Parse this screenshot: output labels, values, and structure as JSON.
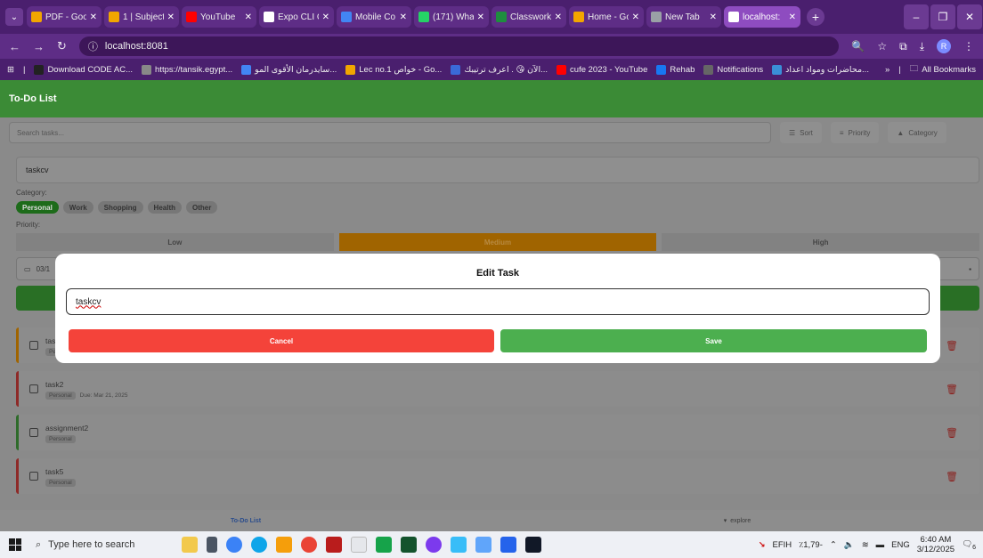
{
  "browser": {
    "tabs": [
      {
        "title": "PDF - Goo",
        "color": "#f2a600"
      },
      {
        "title": "1 | Subject",
        "color": "#f2a600"
      },
      {
        "title": "YouTube",
        "color": "#ff0000"
      },
      {
        "title": "Expo CLI C",
        "color": "#ffffff"
      },
      {
        "title": "Mobile Co",
        "color": "#4285f4"
      },
      {
        "title": "(171) Wha",
        "color": "#25d366"
      },
      {
        "title": "Classwork",
        "color": "#1e8e3e"
      },
      {
        "title": "Home - Go",
        "color": "#f2a600"
      },
      {
        "title": "New Tab",
        "color": "#9aa0a6"
      },
      {
        "title": "localhost:",
        "color": "#ffffff",
        "active": true
      }
    ],
    "url": "localhost:8081",
    "profile_initial": "R",
    "bookmarks": [
      {
        "label": "Download CODE AC...",
        "color": "#222"
      },
      {
        "label": "https://tansik.egypt...",
        "color": "#888"
      },
      {
        "label": "سايدرمان الأقوى المو...",
        "color": "#4285f4"
      },
      {
        "label": "Lec no.1 خواص - Go...",
        "color": "#f2a600"
      },
      {
        "label": "الآن 😘 . اعرف ترتيبك...",
        "color": "#3a6ad8"
      },
      {
        "label": "cufe 2023 - YouTube",
        "color": "#ff0000"
      },
      {
        "label": "Rehab",
        "color": "#1877f2"
      },
      {
        "label": "Notifications",
        "color": "#666"
      },
      {
        "label": "محاضرات ومواد اعداد...",
        "color": "#3a8fd8"
      }
    ],
    "bookmarks_more": "»",
    "all_bookmarks": "All Bookmarks"
  },
  "app": {
    "title": "To-Do List",
    "search_placeholder": "Search tasks...",
    "sort_label": "Sort",
    "priority_label": "Priority",
    "category_label": "Category",
    "task_input_value": "taskcv",
    "category_heading": "Category:",
    "categories": [
      {
        "label": "Personal",
        "active": true
      },
      {
        "label": "Work"
      },
      {
        "label": "Shopping"
      },
      {
        "label": "Health"
      },
      {
        "label": "Other"
      }
    ],
    "priority_heading": "Priority:",
    "priorities": [
      {
        "label": "Low"
      },
      {
        "label": "Medium",
        "active": true
      },
      {
        "label": "High"
      }
    ],
    "date_value": "03/1",
    "tasks": [
      {
        "name": "task",
        "tag": "Pe",
        "due": "",
        "accent": "orange"
      },
      {
        "name": "task2",
        "tag": "Personal",
        "due": "Due: Mar 21, 2025",
        "accent": "red"
      },
      {
        "name": "assignment2",
        "tag": "Personal",
        "due": "",
        "accent": "green"
      },
      {
        "name": "task5",
        "tag": "Personal",
        "due": "",
        "accent": "red"
      }
    ],
    "bottom_nav": [
      {
        "label": "To-Do List",
        "active": true
      },
      {
        "label": "explore"
      }
    ]
  },
  "modal": {
    "title": "Edit Task",
    "input_value": "taskcv",
    "cancel_label": "Cancel",
    "save_label": "Save"
  },
  "taskbar": {
    "search_placeholder": "Type here to search",
    "stock": "EFIH",
    "stock_change": "٪1,79-",
    "lang": "ENG",
    "time": "6:40 AM",
    "date": "3/12/2025",
    "notif_count": "6"
  }
}
